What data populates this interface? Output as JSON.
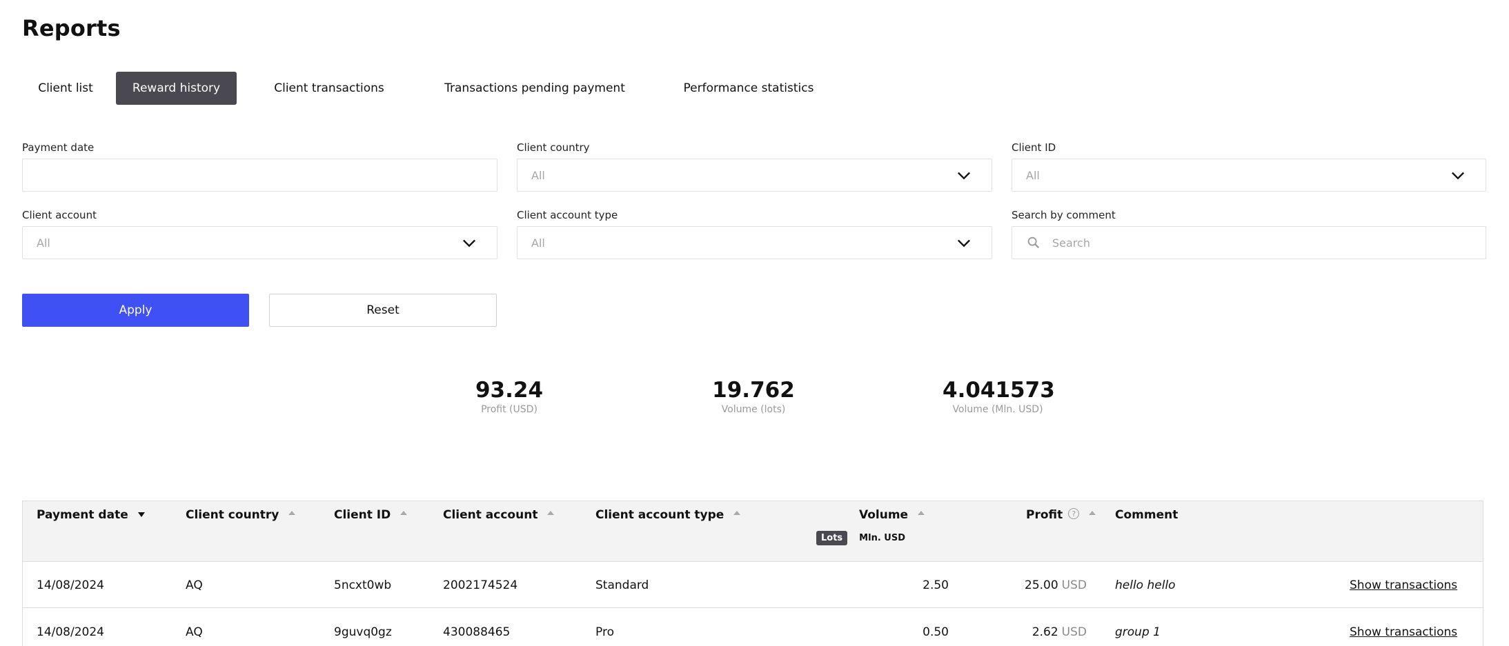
{
  "page": {
    "title": "Reports"
  },
  "tabs": [
    {
      "label": "Client list",
      "active": false
    },
    {
      "label": "Reward history",
      "active": true
    },
    {
      "label": "Client transactions",
      "active": false
    },
    {
      "label": "Transactions pending payment",
      "active": false
    },
    {
      "label": "Performance statistics",
      "active": false
    }
  ],
  "filters": {
    "payment_date": {
      "label": "Payment date",
      "value": ""
    },
    "client_country": {
      "label": "Client country",
      "value": "All"
    },
    "client_id": {
      "label": "Client ID",
      "value": "All"
    },
    "client_account": {
      "label": "Client account",
      "value": "All"
    },
    "client_account_type": {
      "label": "Client account type",
      "value": "All"
    },
    "search_by_comment": {
      "label": "Search by comment",
      "placeholder": "Search"
    }
  },
  "buttons": {
    "apply": "Apply",
    "reset": "Reset"
  },
  "summary": [
    {
      "value": "93.24",
      "label": "Profit (USD)"
    },
    {
      "value": "19.762",
      "label": "Volume (lots)"
    },
    {
      "value": "4.041573",
      "label": "Volume (Mln. USD)"
    }
  ],
  "table": {
    "columns": {
      "payment_date": "Payment date",
      "client_country": "Client country",
      "client_id": "Client ID",
      "client_account": "Client account",
      "client_account_type": "Client account type",
      "volume": "Volume",
      "profit": "Profit",
      "comment": "Comment"
    },
    "volume_units": {
      "active": "Lots",
      "inactive": "Mln. USD"
    },
    "help_glyph": "?",
    "rows": [
      {
        "payment_date": "14/08/2024",
        "client_country": "AQ",
        "client_id": "5ncxt0wb",
        "client_account": "2002174524",
        "client_account_type": "Standard",
        "volume": "2.50",
        "profit": "25.00",
        "currency": "USD",
        "comment": "hello hello",
        "action": "Show transactions"
      },
      {
        "payment_date": "14/08/2024",
        "client_country": "AQ",
        "client_id": "9guvq0gz",
        "client_account": "430088465",
        "client_account_type": "Pro",
        "volume": "0.50",
        "profit": "2.62",
        "currency": "USD",
        "comment": "group 1",
        "action": "Show transactions"
      }
    ]
  }
}
